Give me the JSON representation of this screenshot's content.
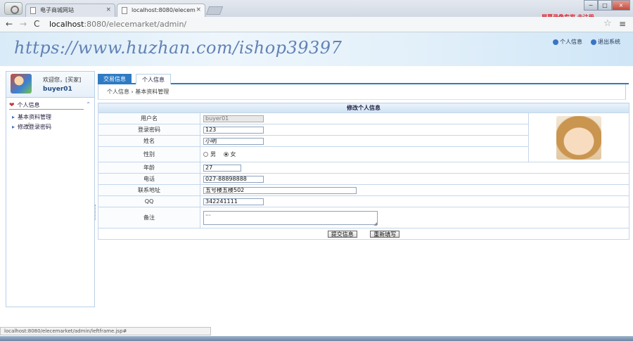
{
  "browser": {
    "tabs": [
      {
        "label": "电子商城网站"
      },
      {
        "label": "localhost:8080/elecem",
        "close": "×"
      }
    ],
    "tab1_close": "×",
    "recording_note": "屏幕录像专家 未注册",
    "window_controls": {
      "minimize": "−",
      "restore": "□",
      "close": "×"
    },
    "address": {
      "host": "localhost",
      "path": ":8080/elecemarket/admin/"
    },
    "status_url": "localhost:8080/elecemarket/admin/leftframe.jsp#"
  },
  "banner": {
    "watermark": "https://www.huzhan.com/ishop39397",
    "links": {
      "profile": "个人信息",
      "logout": "退出系统"
    }
  },
  "sidebar": {
    "welcome": "欢迎您，[买家]",
    "username": "buyer01",
    "menu_title": "个人信息",
    "items": [
      "基本资料管理",
      "修改登录密码"
    ]
  },
  "content": {
    "tabs": [
      "交易信息",
      "个人信息"
    ],
    "breadcrumb": "个人信息 › 基本资料管理",
    "form_title": "修改个人信息",
    "fields": {
      "username": {
        "label": "用户名",
        "value": "buyer01"
      },
      "password": {
        "label": "登录密码",
        "value": "123"
      },
      "name": {
        "label": "姓名",
        "value": "小明"
      },
      "gender": {
        "label": "性别",
        "male": "男",
        "female": "女",
        "selected": "女"
      },
      "age": {
        "label": "年龄",
        "value": "27"
      },
      "phone": {
        "label": "电话",
        "value": "027-88898888"
      },
      "address": {
        "label": "联系地址",
        "value": "五号楼五楼502"
      },
      "qq": {
        "label": "QQ",
        "value": "342241111"
      },
      "remark": {
        "label": "备注",
        "value": "···"
      }
    },
    "buttons": {
      "submit": "提交信息",
      "reset": "重新填写"
    }
  },
  "colors": {
    "accent": "#2e7bc4",
    "border": "#b9d0e6",
    "recording_note": "#e3242b"
  }
}
